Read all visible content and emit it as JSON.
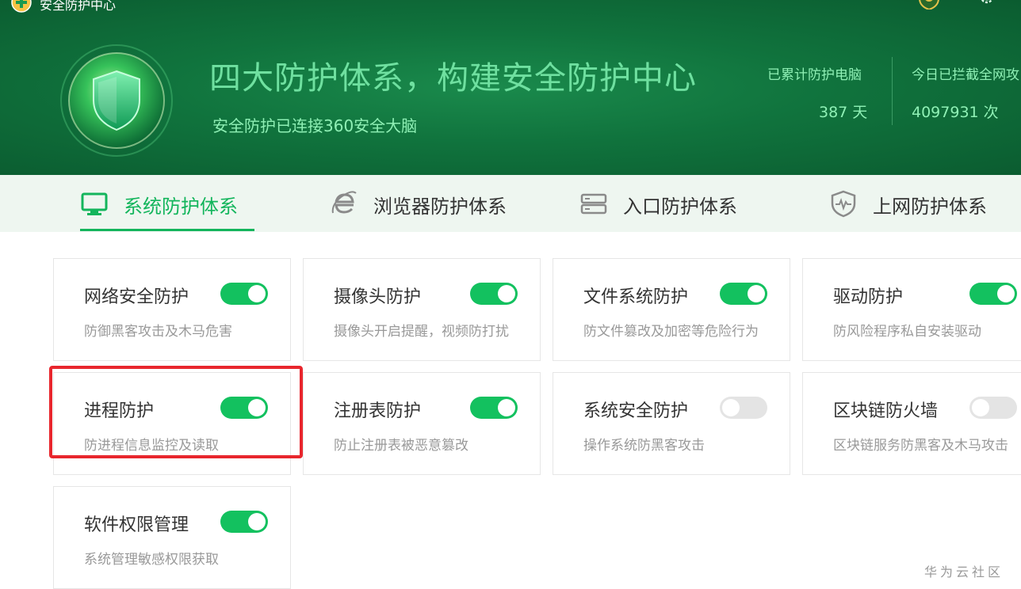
{
  "window": {
    "title": "安全防护中心",
    "logo_icon": "360-logo-icon",
    "badge_icon": "shield-badge-icon",
    "settings_icon": "gear-icon"
  },
  "hero": {
    "headline": "四大防护体系，构建安全防护中心",
    "subline": "安全防护已连接360安全大脑",
    "stats": [
      {
        "label": "已累计防护电脑",
        "value": "387 天"
      },
      {
        "label": "今日已拦截全网攻",
        "value": "4097931 次"
      }
    ]
  },
  "tabs": [
    {
      "label": "系统防护体系",
      "icon": "monitor-icon",
      "active": true
    },
    {
      "label": "浏览器防护体系",
      "icon": "browser-icon",
      "active": false
    },
    {
      "label": "入口防护体系",
      "icon": "server-icon",
      "active": false
    },
    {
      "label": "上网防护体系",
      "icon": "shield-pulse-icon",
      "active": false
    }
  ],
  "cards": [
    {
      "title": "网络安全防护",
      "desc": "防御黑客攻击及木马危害",
      "enabled": true
    },
    {
      "title": "摄像头防护",
      "desc": "摄像头开启提醒，视频防打扰",
      "enabled": true
    },
    {
      "title": "文件系统防护",
      "desc": "防文件篡改及加密等危险行为",
      "enabled": true
    },
    {
      "title": "驱动防护",
      "desc": "防风险程序私自安装驱动",
      "enabled": true
    },
    {
      "title": "进程防护",
      "desc": "防进程信息监控及读取",
      "enabled": true
    },
    {
      "title": "注册表防护",
      "desc": "防止注册表被恶意篡改",
      "enabled": true
    },
    {
      "title": "系统安全防护",
      "desc": "操作系统防黑客攻击",
      "enabled": false
    },
    {
      "title": "区块链防火墙",
      "desc": "区块链服务防黑客及木马攻击",
      "enabled": false
    },
    {
      "title": "软件权限管理",
      "desc": "系统管理敏感权限获取",
      "enabled": true
    }
  ],
  "watermark": "华为云社区",
  "colors": {
    "accent": "#13b55c",
    "toggle_on": "#13c15f",
    "toggle_off": "#e4e4e4",
    "highlight": "#e8262d"
  }
}
